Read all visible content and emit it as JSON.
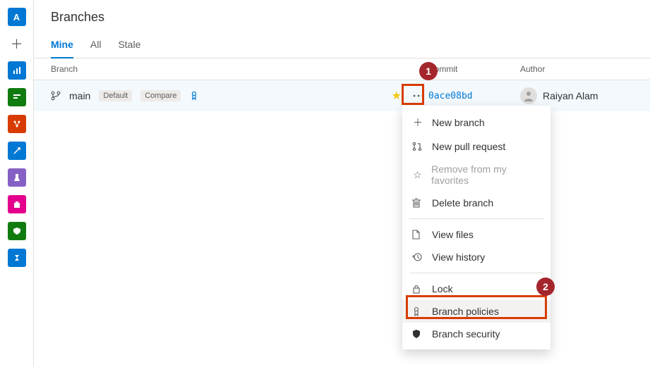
{
  "header": {
    "title": "Branches"
  },
  "tabs": [
    {
      "label": "Mine",
      "active": true
    },
    {
      "label": "All",
      "active": false
    },
    {
      "label": "Stale",
      "active": false
    }
  ],
  "columns": {
    "branch": "Branch",
    "commit": "Commit",
    "author": "Author"
  },
  "row": {
    "name": "main",
    "default_badge": "Default",
    "compare_badge": "Compare",
    "commit": "0ace08bd",
    "author": "Raiyan Alam"
  },
  "menu": {
    "new_branch": "New branch",
    "new_pr": "New pull request",
    "remove_fav": "Remove from my favorites",
    "delete": "Delete branch",
    "view_files": "View files",
    "view_history": "View history",
    "lock": "Lock",
    "policies": "Branch policies",
    "security": "Branch security"
  },
  "callouts": {
    "n1": "1",
    "n2": "2"
  },
  "rail": {
    "avatar_letter": "A"
  }
}
